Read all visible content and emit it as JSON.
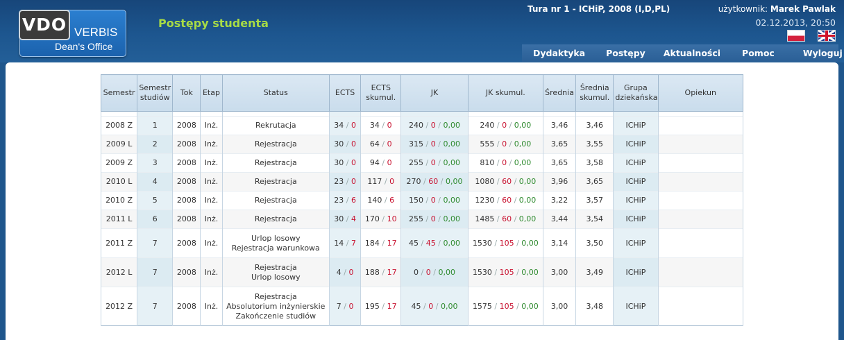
{
  "logo": {
    "vdo": "VDO",
    "verbis": "VERBIS",
    "dean": "Dean's Office"
  },
  "page_title": "Postępy studenta",
  "tura": "Tura nr 1 - ICHiP, 2008 (I,D,PL)",
  "user": {
    "label": "użytkownik:",
    "name": "Marek Pawlak"
  },
  "datetime": "02.12.2013, 20:50",
  "nav": [
    "Dydaktyka",
    "Postępy",
    "Aktualności",
    "Pomoc",
    "Wyloguj"
  ],
  "table": {
    "headers": [
      "Semestr",
      "Semestr studiów",
      "Tok",
      "Etap",
      "Status",
      "ECTS",
      "ECTS skumul.",
      "JK",
      "JK skumul.",
      "Średnia",
      "Średnia skumul.",
      "Grupa dziekańska",
      "Opiekun"
    ],
    "rows": [
      {
        "sem": "2008 Z",
        "sem_st": "1",
        "tok": "2008",
        "etap": "Inż.",
        "status": [
          "Rekrutacja"
        ],
        "ects": [
          "34",
          "0"
        ],
        "ects_sk": [
          "34",
          "0"
        ],
        "jk": [
          "240",
          "0",
          "0,00"
        ],
        "jk_sk": [
          "240",
          "0",
          "0,00"
        ],
        "sr": "3,46",
        "sr_sk": "3,46",
        "grupa": "ICHiP",
        "opiekun": ""
      },
      {
        "sem": "2009 L",
        "sem_st": "2",
        "tok": "2008",
        "etap": "Inż.",
        "status": [
          "Rejestracja"
        ],
        "ects": [
          "30",
          "0"
        ],
        "ects_sk": [
          "64",
          "0"
        ],
        "jk": [
          "315",
          "0",
          "0,00"
        ],
        "jk_sk": [
          "555",
          "0",
          "0,00"
        ],
        "sr": "3,65",
        "sr_sk": "3,55",
        "grupa": "ICHiP",
        "opiekun": ""
      },
      {
        "sem": "2009 Z",
        "sem_st": "3",
        "tok": "2008",
        "etap": "Inż.",
        "status": [
          "Rejestracja"
        ],
        "ects": [
          "30",
          "0"
        ],
        "ects_sk": [
          "94",
          "0"
        ],
        "jk": [
          "255",
          "0",
          "0,00"
        ],
        "jk_sk": [
          "810",
          "0",
          "0,00"
        ],
        "sr": "3,65",
        "sr_sk": "3,58",
        "grupa": "ICHiP",
        "opiekun": ""
      },
      {
        "sem": "2010 L",
        "sem_st": "4",
        "tok": "2008",
        "etap": "Inż.",
        "status": [
          "Rejestracja"
        ],
        "ects": [
          "23",
          "0"
        ],
        "ects_sk": [
          "117",
          "0"
        ],
        "jk": [
          "270",
          "60",
          "0,00"
        ],
        "jk_sk": [
          "1080",
          "60",
          "0,00"
        ],
        "sr": "3,96",
        "sr_sk": "3,65",
        "grupa": "ICHiP",
        "opiekun": ""
      },
      {
        "sem": "2010 Z",
        "sem_st": "5",
        "tok": "2008",
        "etap": "Inż.",
        "status": [
          "Rejestracja"
        ],
        "ects": [
          "23",
          "6"
        ],
        "ects_sk": [
          "140",
          "6"
        ],
        "jk": [
          "150",
          "0",
          "0,00"
        ],
        "jk_sk": [
          "1230",
          "60",
          "0,00"
        ],
        "sr": "3,22",
        "sr_sk": "3,57",
        "grupa": "ICHiP",
        "opiekun": ""
      },
      {
        "sem": "2011 L",
        "sem_st": "6",
        "tok": "2008",
        "etap": "Inż.",
        "status": [
          "Rejestracja"
        ],
        "ects": [
          "30",
          "4"
        ],
        "ects_sk": [
          "170",
          "10"
        ],
        "jk": [
          "255",
          "0",
          "0,00"
        ],
        "jk_sk": [
          "1485",
          "60",
          "0,00"
        ],
        "sr": "3,44",
        "sr_sk": "3,54",
        "grupa": "ICHiP",
        "opiekun": ""
      },
      {
        "sem": "2011 Z",
        "sem_st": "7",
        "tok": "2008",
        "etap": "Inż.",
        "status": [
          "Urlop losowy",
          "Rejestracja warunkowa"
        ],
        "ects": [
          "14",
          "7"
        ],
        "ects_sk": [
          "184",
          "17"
        ],
        "jk": [
          "45",
          "45",
          "0,00"
        ],
        "jk_sk": [
          "1530",
          "105",
          "0,00"
        ],
        "sr": "3,14",
        "sr_sk": "3,50",
        "grupa": "ICHiP",
        "opiekun": ""
      },
      {
        "sem": "2012 L",
        "sem_st": "7",
        "tok": "2008",
        "etap": "Inż.",
        "status": [
          "Rejestracja",
          "Urlop losowy"
        ],
        "ects": [
          "4",
          "0"
        ],
        "ects_sk": [
          "188",
          "17"
        ],
        "jk": [
          "0",
          "0",
          "0,00"
        ],
        "jk_sk": [
          "1530",
          "105",
          "0,00"
        ],
        "sr": "3,00",
        "sr_sk": "3,49",
        "grupa": "ICHiP",
        "opiekun": ""
      },
      {
        "sem": "2012 Z",
        "sem_st": "7",
        "tok": "2008",
        "etap": "Inż.",
        "status": [
          "Rejestracja",
          "Absolutorium inżynierskie",
          "Zakończenie studiów"
        ],
        "ects": [
          "7",
          "0"
        ],
        "ects_sk": [
          "195",
          "17"
        ],
        "jk": [
          "45",
          "0",
          "0,00"
        ],
        "jk_sk": [
          "1575",
          "105",
          "0,00"
        ],
        "sr": "3,00",
        "sr_sk": "3,48",
        "grupa": "ICHiP",
        "opiekun": ""
      }
    ]
  }
}
